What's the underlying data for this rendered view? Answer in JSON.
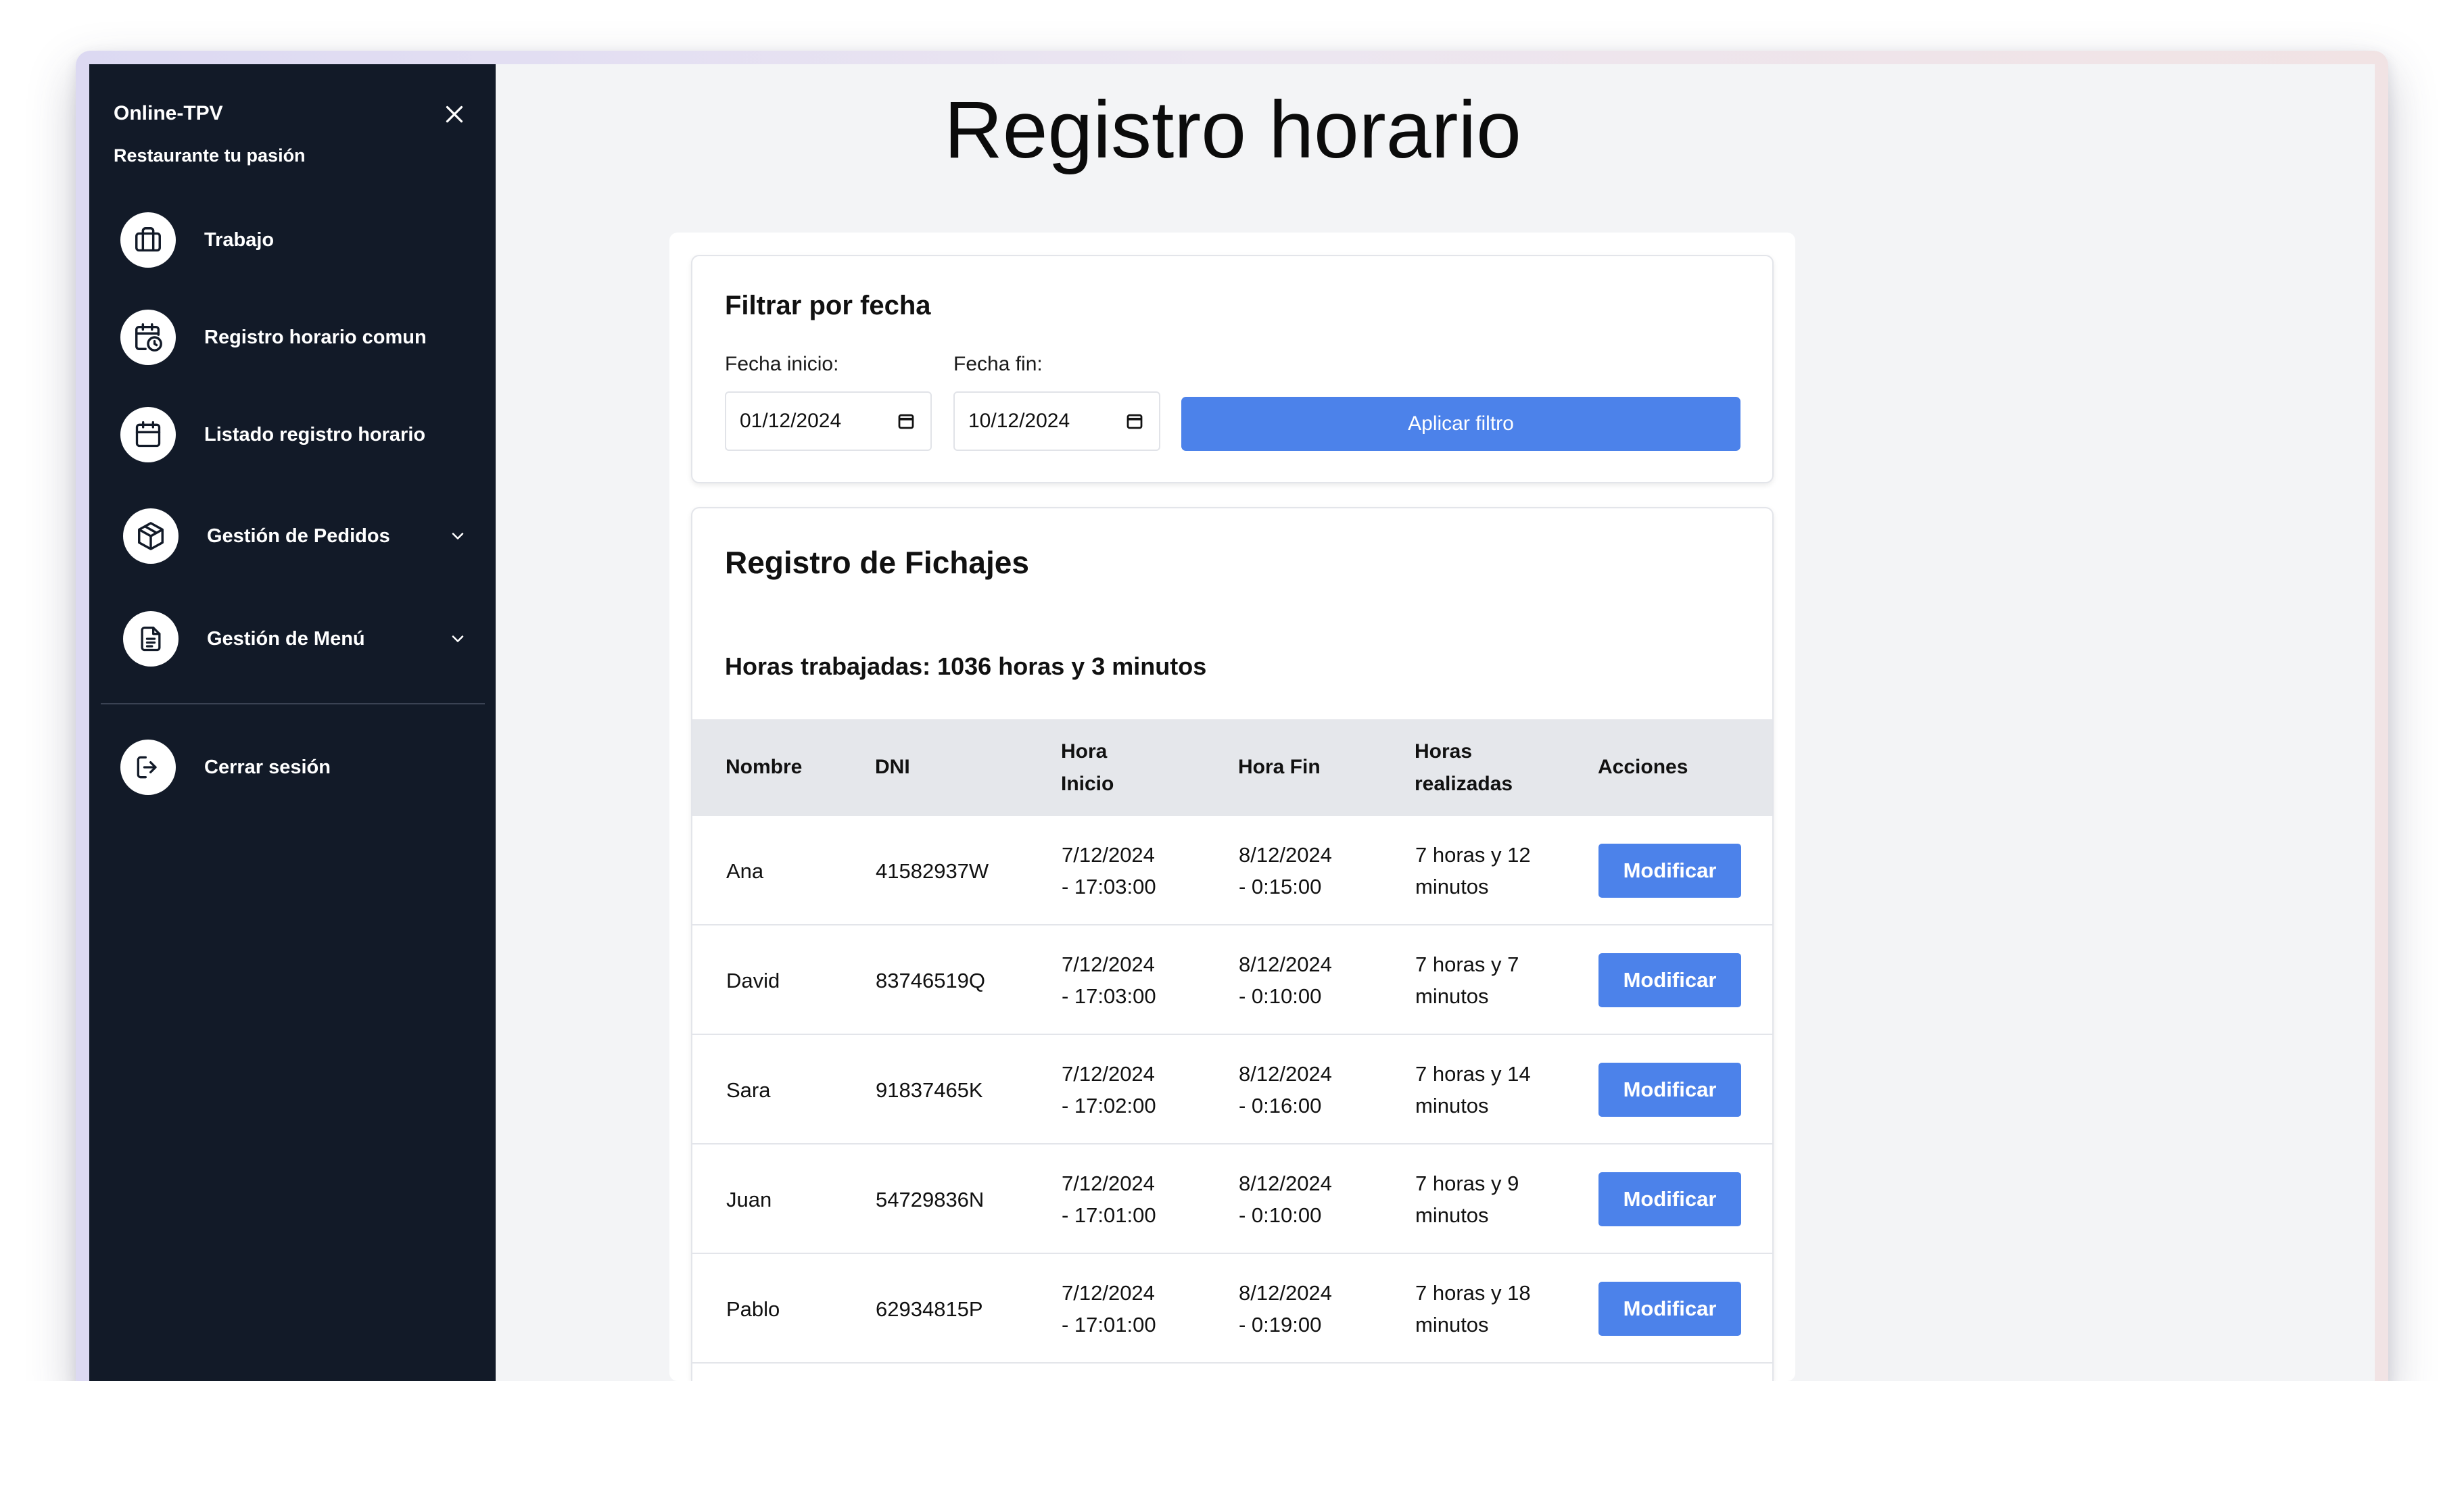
{
  "sidebar": {
    "title": "Online-TPV",
    "subtitle": "Restaurante tu pasión",
    "items": [
      {
        "label": "Trabajo",
        "icon": "briefcase-icon"
      },
      {
        "label": "Registro horario comun",
        "icon": "calendar-clock-icon"
      },
      {
        "label": "Listado registro horario",
        "icon": "calendar-icon"
      },
      {
        "label": "Gestión de Pedidos",
        "icon": "package-icon"
      },
      {
        "label": "Gestión de Menú",
        "icon": "document-icon"
      }
    ],
    "logout_label": "Cerrar sesión"
  },
  "page": {
    "title": "Registro horario"
  },
  "filter": {
    "heading": "Filtrar por fecha",
    "start_label": "Fecha inicio:",
    "start_value": "01/12/2024",
    "end_label": "Fecha fin:",
    "end_value": "10/12/2024",
    "apply_label": "Aplicar filtro"
  },
  "records": {
    "heading": "Registro de Fichajes",
    "summary": "Horas trabajadas: 1036 horas y 3 minutos",
    "columns": {
      "name": "Nombre",
      "dni": "DNI",
      "start_line1": "Hora",
      "start_line2": "Inicio",
      "end": "Hora Fin",
      "done_line1": "Horas",
      "done_line2": "realizadas",
      "actions": "Acciones"
    },
    "rows": [
      {
        "name": "Ana",
        "dni": "41582937W",
        "start_date": "7/12/2024",
        "start_time": "- 17:03:00",
        "end_date": "8/12/2024",
        "end_time": "- 0:15:00",
        "hours_line1": "7 horas y 12",
        "hours_line2": "minutos",
        "action": "Modificar"
      },
      {
        "name": "David",
        "dni": "83746519Q",
        "start_date": "7/12/2024",
        "start_time": "- 17:03:00",
        "end_date": "8/12/2024",
        "end_time": "- 0:10:00",
        "hours_line1": "7 horas y 7",
        "hours_line2": "minutos",
        "action": "Modificar"
      },
      {
        "name": "Sara",
        "dni": "91837465K",
        "start_date": "7/12/2024",
        "start_time": "- 17:02:00",
        "end_date": "8/12/2024",
        "end_time": "- 0:16:00",
        "hours_line1": "7 horas y 14",
        "hours_line2": "minutos",
        "action": "Modificar"
      },
      {
        "name": "Juan",
        "dni": "54729836N",
        "start_date": "7/12/2024",
        "start_time": "- 17:01:00",
        "end_date": "8/12/2024",
        "end_time": "- 0:10:00",
        "hours_line1": "7 horas y 9",
        "hours_line2": "minutos",
        "action": "Modificar"
      },
      {
        "name": "Pablo",
        "dni": "62934815P",
        "start_date": "7/12/2024",
        "start_time": "- 17:01:00",
        "end_date": "8/12/2024",
        "end_time": "- 0:19:00",
        "hours_line1": "7 horas y 18",
        "hours_line2": "minutos",
        "action": "Modificar"
      }
    ]
  },
  "colors": {
    "sidebar_bg": "#121a28",
    "accent": "#4c82ea",
    "page_bg": "#f3f4f6",
    "table_header_bg": "#e5e7eb"
  }
}
